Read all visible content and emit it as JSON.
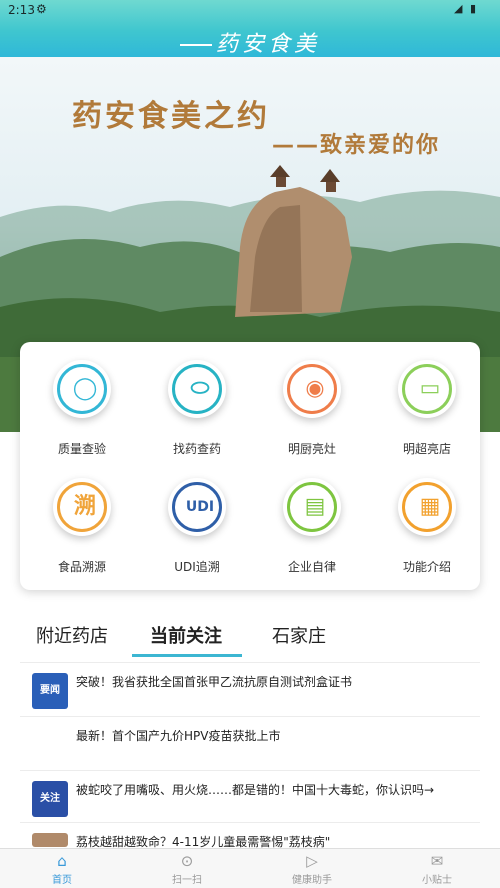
{
  "status_bar": {
    "time": "2:13",
    "gear_icon": "⚙",
    "right_icons": "◢ ▮"
  },
  "header": {
    "logo_text": "药安食美"
  },
  "banner": {
    "title": "药安食美之约",
    "subtitle": "——致亲爱的你"
  },
  "features": [
    {
      "label": "质量查验",
      "icon": "search-icon",
      "color": "#33b7d6",
      "glyph": "🔍"
    },
    {
      "label": "找药查药",
      "icon": "pill-icon",
      "color": "#27b3c4",
      "glyph": "💊"
    },
    {
      "label": "明厨亮灶",
      "icon": "camera-icon",
      "color": "#ef7d4a",
      "glyph": "◉"
    },
    {
      "label": "明超亮店",
      "icon": "monitor-icon",
      "color": "#8ccf5a",
      "glyph": "▭"
    },
    {
      "label": "食品溯源",
      "icon": "trace-icon",
      "color": "#f0a43a",
      "glyph": "溯"
    },
    {
      "label": "UDI追溯",
      "icon": "udi-icon",
      "color": "#2f5fa8",
      "glyph": "UDI"
    },
    {
      "label": "企业自律",
      "icon": "chat-icon",
      "color": "#7ec540",
      "glyph": "▤"
    },
    {
      "label": "功能介绍",
      "icon": "grid-icon",
      "color": "#f2a12e",
      "glyph": "▦"
    }
  ],
  "tabs": [
    {
      "label": "附近药店"
    },
    {
      "label": "当前关注",
      "active": true
    },
    {
      "label": "石家庄"
    }
  ],
  "news": [
    {
      "text": "突破！我省获批全国首张甲乙流抗原自测试剂盒证书",
      "thumb": "要闻",
      "thumb_color": "#2a5fb8"
    },
    {
      "text": "最新！首个国产九价HPV疫苗获批上市",
      "thumb": "",
      "thumb_color": "#ffffff"
    },
    {
      "text": "被蛇咬了用嘴吸、用火烧……都是错的！中国十大毒蛇，你认识吗→",
      "thumb": "关注",
      "thumb_color": "#2a4fa6"
    },
    {
      "text": "荔枝越甜越致命？4-11岁儿童最需警惕\"荔枝病\"",
      "thumb": "",
      "thumb_color": "#b08a6a"
    }
  ],
  "bottom_nav": [
    {
      "label": "首页",
      "icon": "home-icon",
      "glyph": "⌂",
      "active": true
    },
    {
      "label": "扫一扫",
      "icon": "camera-icon",
      "glyph": "⊙"
    },
    {
      "label": "健康助手",
      "icon": "video-icon",
      "glyph": "▷"
    },
    {
      "label": "小贴士",
      "icon": "mail-icon",
      "glyph": "✉"
    }
  ]
}
